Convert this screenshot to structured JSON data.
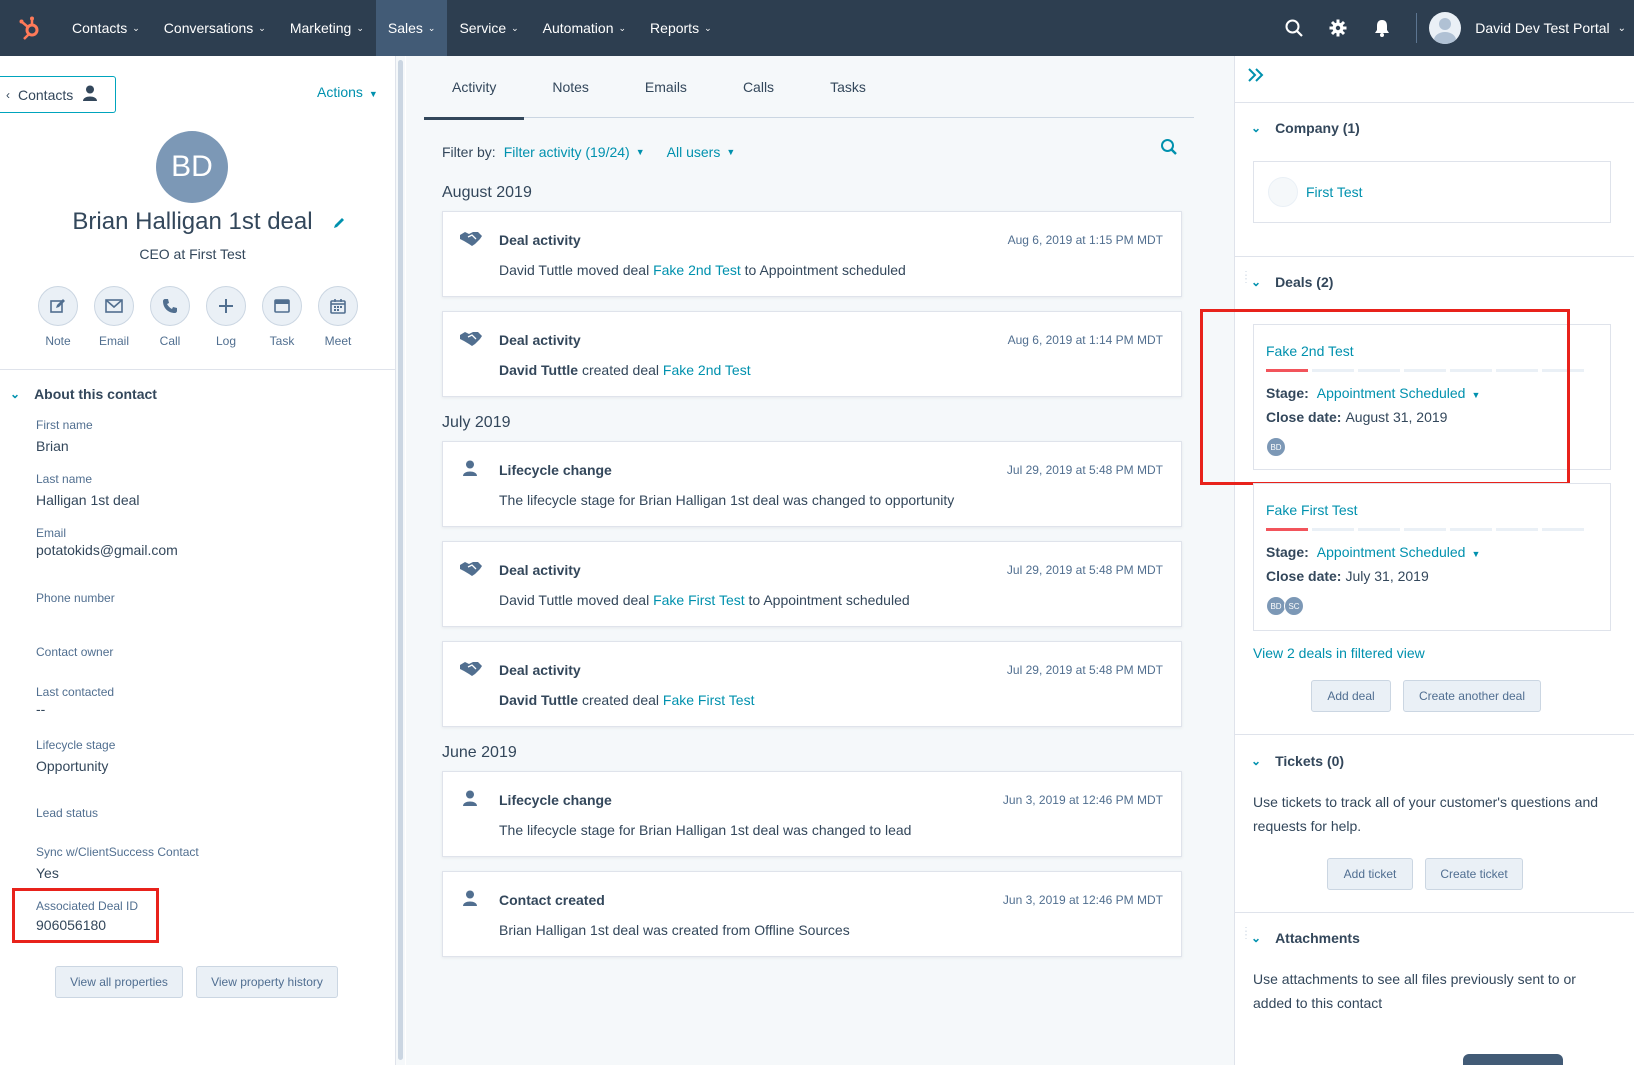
{
  "topnav": {
    "items": [
      {
        "label": "Contacts",
        "active": false
      },
      {
        "label": "Conversations",
        "active": false
      },
      {
        "label": "Marketing",
        "active": false
      },
      {
        "label": "Sales",
        "active": true
      },
      {
        "label": "Service",
        "active": false
      },
      {
        "label": "Automation",
        "active": false
      },
      {
        "label": "Reports",
        "active": false
      }
    ],
    "portal_name": "David Dev Test Portal",
    "icons": [
      "search-icon",
      "gear-icon",
      "bell-icon"
    ],
    "brand_color": "#ff7a59"
  },
  "left": {
    "back_label": "Contacts",
    "actions_label": "Actions",
    "avatar_initials": "BD",
    "name": "Brian Halligan 1st deal",
    "title": "CEO at First Test",
    "quick_actions": [
      {
        "label": "Note",
        "icon": "note-icon"
      },
      {
        "label": "Email",
        "icon": "email-icon"
      },
      {
        "label": "Call",
        "icon": "phone-icon"
      },
      {
        "label": "Log",
        "icon": "plus-icon"
      },
      {
        "label": "Task",
        "icon": "task-icon"
      },
      {
        "label": "Meet",
        "icon": "calendar-icon"
      }
    ],
    "about_heading": "About this contact",
    "properties": [
      {
        "label": "First name",
        "value": "Brian"
      },
      {
        "label": "Last name",
        "value": "Halligan 1st deal"
      },
      {
        "label": "Email",
        "value": "potatokids@gmail.com"
      },
      {
        "label": "Phone number",
        "value": ""
      },
      {
        "label": "Contact owner",
        "value": ""
      },
      {
        "label": "Last contacted",
        "value": "--"
      },
      {
        "label": "Lifecycle stage",
        "value": "Opportunity"
      },
      {
        "label": "Lead status",
        "value": ""
      },
      {
        "label": "Sync w/ClientSuccess Contact",
        "value": "Yes"
      },
      {
        "label": "Associated Deal ID",
        "value": "906056180"
      }
    ],
    "view_all_label": "View all properties",
    "view_history_label": "View property history"
  },
  "middle": {
    "tabs": [
      "Activity",
      "Notes",
      "Emails",
      "Calls",
      "Tasks"
    ],
    "filter_by_label": "Filter by:",
    "filter_activity": "Filter activity (19/24)",
    "all_users": "All users",
    "months": [
      "August 2019",
      "July 2019",
      "June 2019"
    ],
    "cards": [
      {
        "icon": "handshake-icon",
        "title": "Deal activity",
        "time": "Aug 6, 2019 at 1:15 PM MDT",
        "pre": "David Tuttle moved deal ",
        "link": "Fake 2nd Test",
        "post": " to Appointment scheduled",
        "bold_actor": false
      },
      {
        "icon": "handshake-icon",
        "title": "Deal activity",
        "time": "Aug 6, 2019 at 1:14 PM MDT",
        "actor": "David Tuttle",
        "pre": " created deal ",
        "link": "Fake 2nd Test",
        "post": "",
        "bold_actor": true
      },
      {
        "icon": "person-icon",
        "title": "Lifecycle change",
        "time": "Jul 29, 2019 at 5:48 PM MDT",
        "pre": "The lifecycle stage for Brian Halligan 1st deal was changed to opportunity",
        "link": "",
        "post": "",
        "bold_actor": false
      },
      {
        "icon": "handshake-icon",
        "title": "Deal activity",
        "time": "Jul 29, 2019 at 5:48 PM MDT",
        "pre": "David Tuttle moved deal ",
        "link": "Fake First Test",
        "post": " to Appointment scheduled",
        "bold_actor": false
      },
      {
        "icon": "handshake-icon",
        "title": "Deal activity",
        "time": "Jul 29, 2019 at 5:48 PM MDT",
        "actor": "David Tuttle",
        "pre": " created deal ",
        "link": "Fake First Test",
        "post": "",
        "bold_actor": true
      },
      {
        "icon": "person-icon",
        "title": "Lifecycle change",
        "time": "Jun 3, 2019 at 12:46 PM MDT",
        "pre": "The lifecycle stage for Brian Halligan 1st deal was changed to lead",
        "link": "",
        "post": "",
        "bold_actor": false
      },
      {
        "icon": "person-icon",
        "title": "Contact created",
        "time": "Jun 3, 2019 at 12:46 PM MDT",
        "pre": "Brian Halligan 1st deal was created from Offline Sources",
        "link": "",
        "post": "",
        "bold_actor": false
      }
    ]
  },
  "right": {
    "company_heading": "Company (1)",
    "company_name": "First Test",
    "deals_heading": "Deals (2)",
    "deals": [
      {
        "name": "Fake 2nd Test",
        "stage_label": "Stage:",
        "stage": "Appointment Scheduled",
        "close_label": "Close date:",
        "close": "August 31, 2019",
        "owners": [
          "BD"
        ]
      },
      {
        "name": "Fake First Test",
        "stage_label": "Stage:",
        "stage": "Appointment Scheduled",
        "close_label": "Close date:",
        "close": "July 31, 2019",
        "owners": [
          "BD",
          "SC"
        ]
      }
    ],
    "view_deals_link": "View 2 deals in filtered view",
    "add_deal": "Add deal",
    "create_deal": "Create another deal",
    "tickets_heading": "Tickets (0)",
    "tickets_text": "Use tickets to track all of your customer's questions and requests for help.",
    "add_ticket": "Add ticket",
    "create_ticket": "Create ticket",
    "attachments_heading": "Attachments",
    "attachments_text": "Use attachments to see all files previously sent to or added to this contact"
  },
  "colors": {
    "link": "#0091ae",
    "highlight": "#e8221b",
    "nav_bg": "#2d3e50"
  }
}
